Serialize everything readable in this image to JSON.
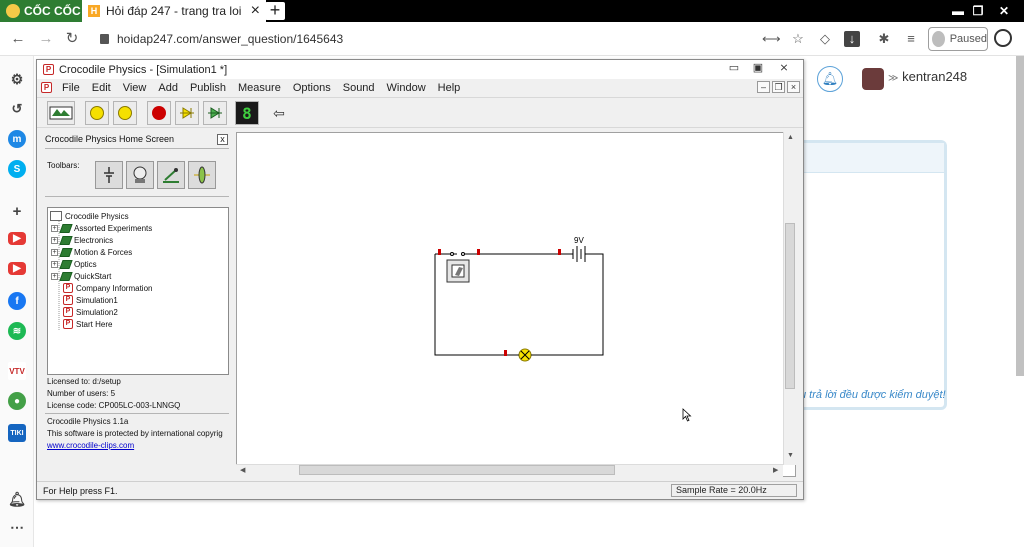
{
  "browser": {
    "brand": "CỐC CỐC",
    "tab_favicon": "H",
    "tab_title": "Hỏi đáp 247 - trang tra loi",
    "url": "hoidap247.com/answer_question/1645643",
    "profile_status": "Paused"
  },
  "page": {
    "username": "kentran248",
    "note": "u trả lời đều được kiểm duyệt!"
  },
  "croc": {
    "title": "Crocodile Physics - [Simulation1 *]",
    "menu": [
      "File",
      "Edit",
      "View",
      "Add",
      "Publish",
      "Measure",
      "Options",
      "Sound",
      "Window",
      "Help"
    ],
    "home_title": "Crocodile Physics Home Screen",
    "home_close": "x",
    "toolbars_label": "Toolbars:",
    "tree": {
      "root": "Crocodile Physics",
      "folders": [
        "Assorted Experiments",
        "Electronics",
        "Motion & Forces",
        "Optics",
        "QuickStart"
      ],
      "files": [
        "Company Information",
        "Simulation1",
        "Simulation2",
        "Start Here"
      ]
    },
    "license": {
      "licensed_to": "Licensed to: d:/setup",
      "users": "Number of users: 5",
      "code": "License code: CP005LC-003-LNNGQ"
    },
    "about": {
      "version": "Crocodile Physics 1.1a",
      "copyright": "This software is protected by international copyrig",
      "link": "www.crocodile-clips.com"
    },
    "battery_label": "9V",
    "status_left": "For Help press F1.",
    "sample_rate": "Sample Rate =  20.0Hz"
  },
  "colors": {
    "brand_green": "#2e7d32",
    "link_blue": "#0000cc",
    "lamp_yellow": "#f5e000",
    "terminal_red": "#cc0000"
  }
}
